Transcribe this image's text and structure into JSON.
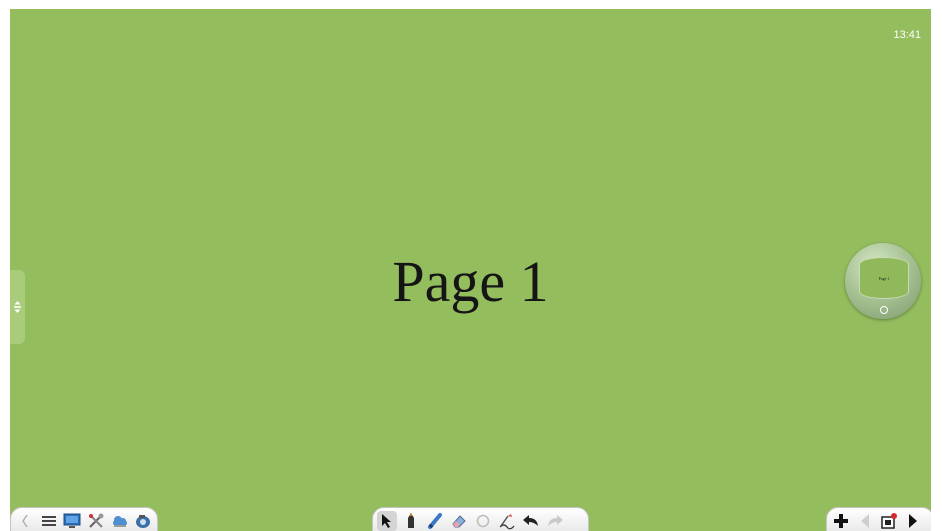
{
  "clock": {
    "time": "13:41"
  },
  "page": {
    "title": "Page 1",
    "background_color": "#94bd5e"
  },
  "page_preview": {
    "label": "Page 1"
  },
  "toolbars": {
    "left": [
      "collapse-arrow-icon",
      "menu-icon",
      "display-icon",
      "tools-icon",
      "cloud-icon",
      "camera-icon"
    ],
    "center": [
      "select-pointer-icon",
      "pen-icon",
      "highlighter-icon",
      "eraser-icon",
      "shape-icon",
      "handwriting-icon",
      "undo-icon",
      "redo-icon"
    ],
    "right": [
      "add-page-icon",
      "previous-page-icon",
      "page-list-icon",
      "next-page-icon"
    ]
  }
}
